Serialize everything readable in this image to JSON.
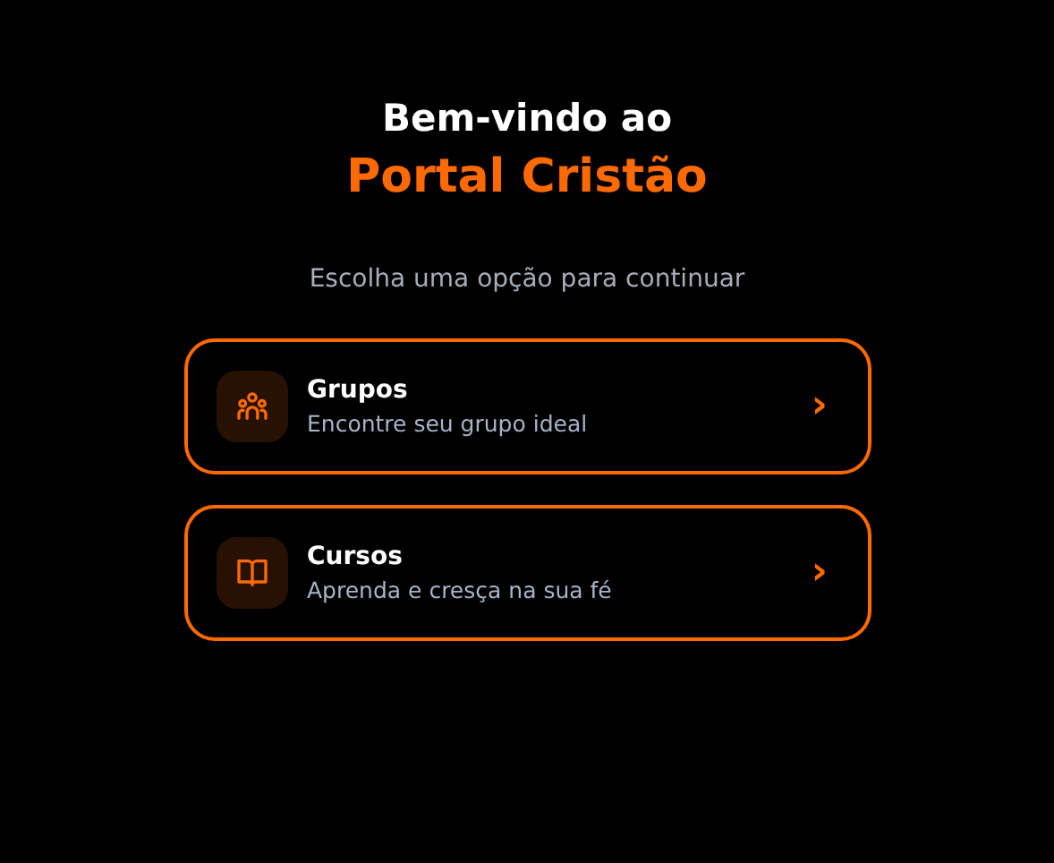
{
  "heading": {
    "line_1": "Bem-vindo ao",
    "line_2": "Portal Cristão"
  },
  "subtitle": "Escolha uma opção para continuar",
  "options": [
    {
      "kind": "groups",
      "title": "Grupos",
      "description": "Encontre seu grupo ideal",
      "chevron": "›"
    },
    {
      "kind": "courses",
      "title": "Cursos",
      "description": "Aprenda e cresça na sua fé",
      "chevron": "›"
    }
  ]
}
